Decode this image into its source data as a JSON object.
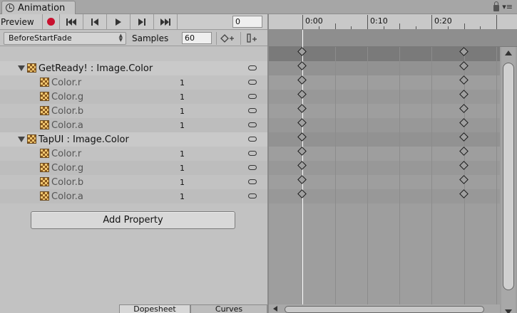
{
  "window": {
    "tab_title": "Animation",
    "tab_icon": "clock-icon",
    "menu_glyph": "▾≡"
  },
  "toolbar": {
    "preview_label": "Preview",
    "record_color": "#c8102e",
    "frame_value": "0",
    "controls": [
      "first-key-icon",
      "prev-key-icon",
      "play-icon",
      "next-key-icon",
      "last-key-icon"
    ]
  },
  "clip": {
    "name": "BeforeStartFade",
    "samples_label": "Samples",
    "samples_value": "60"
  },
  "properties": [
    {
      "label": "GetReady! : Image.Color",
      "kind": "component"
    },
    {
      "label": "Color.r",
      "value": "1",
      "kind": "channel"
    },
    {
      "label": "Color.g",
      "value": "1",
      "kind": "channel"
    },
    {
      "label": "Color.b",
      "value": "1",
      "kind": "channel"
    },
    {
      "label": "Color.a",
      "value": "1",
      "kind": "channel"
    },
    {
      "label": "TapUI : Image.Color",
      "kind": "component"
    },
    {
      "label": "Color.r",
      "value": "1",
      "kind": "channel"
    },
    {
      "label": "Color.g",
      "value": "1",
      "kind": "channel"
    },
    {
      "label": "Color.b",
      "value": "1",
      "kind": "channel"
    },
    {
      "label": "Color.a",
      "value": "1",
      "kind": "channel"
    }
  ],
  "add_property_label": "Add Property",
  "view_tabs": {
    "dopesheet": "Dopesheet",
    "curves": "Curves"
  },
  "timeline": {
    "ruler_labels": [
      "0:00",
      "0:10",
      "0:20"
    ],
    "keyframe_times": [
      "0:00",
      "0:20"
    ]
  }
}
